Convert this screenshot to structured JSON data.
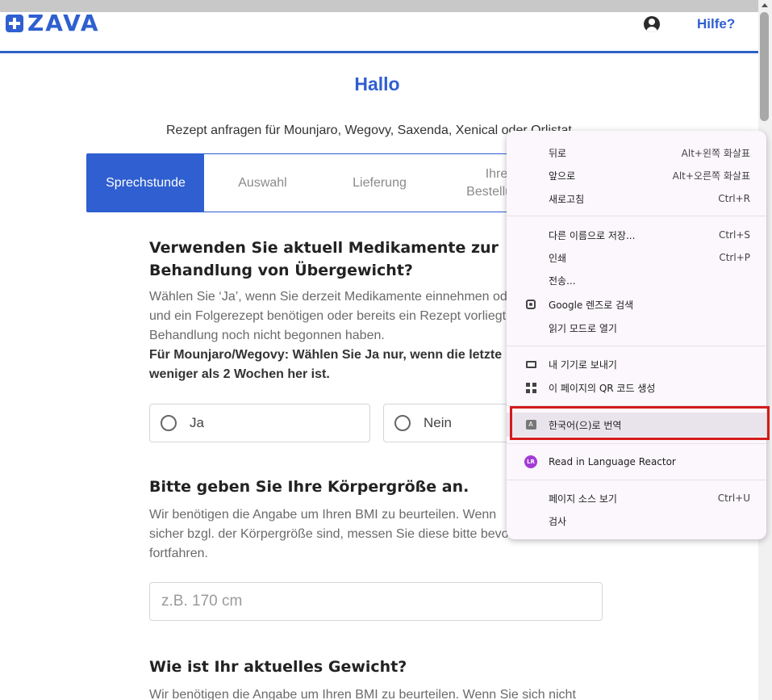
{
  "header": {
    "logo_text": "ZAVA",
    "help_label": "Hilfe?"
  },
  "main": {
    "greeting": "Hallo",
    "subtitle": "Rezept anfragen für Mounjaro, Wegovy, Saxenda, Xenical oder Orlistat",
    "steps": [
      {
        "label": "Sprechstunde",
        "active": true
      },
      {
        "label": "Auswahl",
        "active": false
      },
      {
        "label": "Lieferung",
        "active": false
      },
      {
        "label": "Ihre Bestellung",
        "active": false
      }
    ],
    "q1": {
      "title": "Verwenden Sie aktuell Medikamente zur Behandlung von Übergewicht?",
      "desc_line1": "Wählen Sie ‘Ja’, wenn Sie derzeit Medikamente einnehmen oder",
      "desc_line2": "und ein Folgerezept benötigen oder bereits ein Rezept vorliegt",
      "desc_line3": "Behandlung noch nicht begonnen haben.",
      "desc_bold_line1": "Für Mounjaro/Wegovy: Wählen Sie Ja nur, wenn die letzte",
      "desc_bold_line2": "weniger als 2 Wochen her ist.",
      "option_yes": "Ja",
      "option_no": "Nein"
    },
    "q2": {
      "title": "Bitte geben Sie Ihre Körpergröße an.",
      "desc_line1": "Wir benötigen die Angabe um Ihren BMI zu beurteilen. Wenn",
      "desc_line2": "sicher bzgl. der Körpergröße sind, messen Sie diese bitte bevor",
      "desc_line3": "fortfahren.",
      "placeholder": "z.B. 170 cm"
    },
    "q3": {
      "title": "Wie ist Ihr aktuelles Gewicht?",
      "desc_line1": "Wir benötigen die Angabe um Ihren BMI zu beurteilen. Wenn Sie sich nicht"
    }
  },
  "context_menu": {
    "items": [
      {
        "label": "뒤로",
        "shortcut": "Alt+왼쪽 화살표",
        "icon": ""
      },
      {
        "label": "앞으로",
        "shortcut": "Alt+오른쪽 화살표",
        "icon": ""
      },
      {
        "label": "새로고침",
        "shortcut": "Ctrl+R",
        "icon": ""
      },
      {
        "label": "다른 이름으로 저장...",
        "shortcut": "Ctrl+S",
        "icon": ""
      },
      {
        "label": "인쇄",
        "shortcut": "Ctrl+P",
        "icon": ""
      },
      {
        "label": "전송...",
        "shortcut": "",
        "icon": ""
      },
      {
        "label": "Google 렌즈로 검색",
        "shortcut": "",
        "icon": "lens-icon"
      },
      {
        "label": "읽기 모드로 열기",
        "shortcut": "",
        "icon": ""
      },
      {
        "label": "내 기기로 보내기",
        "shortcut": "",
        "icon": "device-icon"
      },
      {
        "label": "이 페이지의 QR 코드 생성",
        "shortcut": "",
        "icon": "qr-icon"
      },
      {
        "label": "한국어(으)로 번역",
        "shortcut": "",
        "icon": "translate-icon"
      },
      {
        "label": "Read in Language Reactor",
        "shortcut": "",
        "icon": "language-reactor-icon"
      },
      {
        "label": "페이지 소스 보기",
        "shortcut": "Ctrl+U",
        "icon": ""
      },
      {
        "label": "검사",
        "shortcut": "",
        "icon": ""
      }
    ],
    "lr_icon_text": "LR",
    "translate_icon_text": "A"
  },
  "colors": {
    "brand": "#2f5fd0",
    "highlight_border": "#d31b1b"
  }
}
